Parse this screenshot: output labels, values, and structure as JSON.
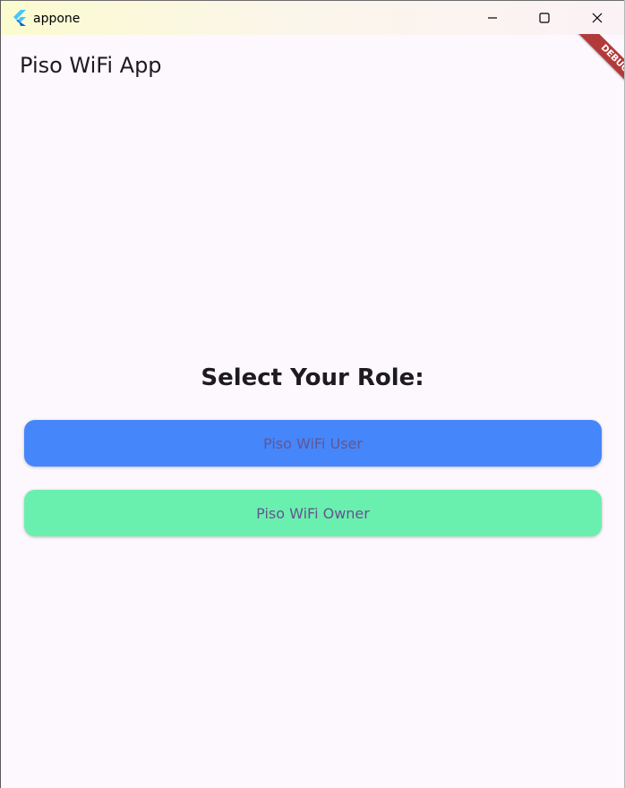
{
  "window": {
    "title": "appone",
    "icon": "flutter-logo-icon"
  },
  "titlebar_controls": {
    "minimize_icon": "minimize-icon",
    "maximize_icon": "maximize-icon",
    "close_icon": "close-icon"
  },
  "appbar": {
    "title": "Piso WiFi App"
  },
  "debug_banner": {
    "label": "DEBUG",
    "color": "#b33a3a"
  },
  "main": {
    "heading": "Select Your Role:",
    "buttons": [
      {
        "label": "Piso WiFi User",
        "color": "#4587fb"
      },
      {
        "label": "Piso WiFi Owner",
        "color": "#6af0ae"
      }
    ]
  },
  "colors": {
    "background": "#fdf7fe",
    "button_text": "#65558f"
  }
}
